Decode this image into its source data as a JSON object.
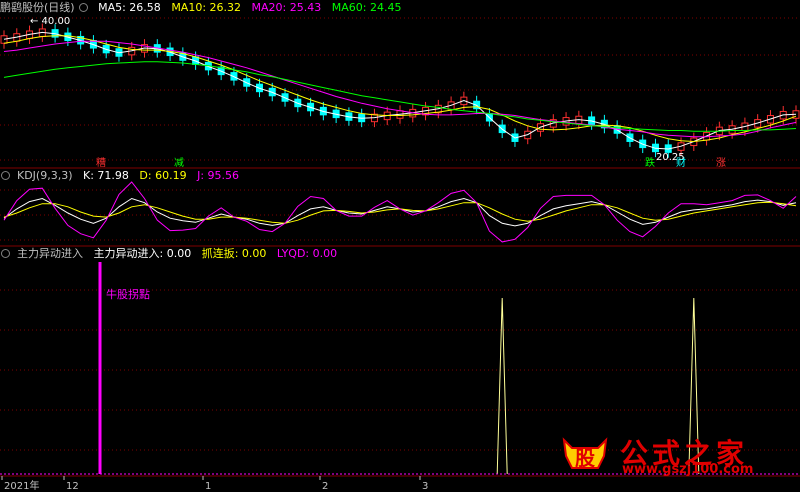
{
  "header_main": {
    "title": "鹏鹞股份(日线)",
    "ma5": "MA5: 26.58",
    "ma10": "MA10: 26.32",
    "ma20": "MA20: 25.43",
    "ma60": "MA60: 24.45"
  },
  "header_kdj": {
    "name": "KDJ(9,3,3)",
    "k": "K: 71.98",
    "d": "D: 60.19",
    "j": "J: 95.56"
  },
  "header_ind": {
    "name": "主力异动进入",
    "v1": "主力异动进入: 0.00",
    "v2": "抓连扳: 0.00",
    "v3": "LYQD: 0.00"
  },
  "colors": {
    "ma5": "#ffffff",
    "ma10": "#ffff00",
    "ma20": "#ff00ff",
    "ma60": "#00ff00",
    "up": "#ff3030",
    "down": "#00ffff",
    "grid": "#800000",
    "signal": "#ff00ff",
    "spike": "#ffff99"
  },
  "chart_data": [
    {
      "type": "candlestick",
      "panel": "price",
      "high_label": "40.00",
      "low_label": "20.25",
      "markers": [
        "糟",
        "减",
        "跌",
        "财",
        "涨"
      ],
      "series": [
        {
          "name": "MA5",
          "values": [
            37.6,
            37.9,
            38.3,
            38.6,
            38.4,
            37.9,
            37.4,
            36.8,
            36.1,
            35.6,
            35.9,
            36.3,
            36.2,
            35.7,
            35.0,
            34.4,
            33.6,
            32.9,
            32.1,
            31.2,
            30.4,
            29.8,
            29.0,
            28.2,
            27.6,
            27.0,
            26.6,
            26.2,
            26.0,
            26.1,
            26.4,
            26.6,
            26.8,
            27.1,
            27.4,
            27.9,
            28.6,
            27.9,
            26.1,
            24.4,
            23.1,
            23.6,
            24.7,
            25.3,
            25.6,
            25.8,
            25.6,
            25.1,
            24.3,
            23.1,
            22.2,
            21.6,
            21.5,
            21.9,
            22.6,
            23.4,
            24.2,
            24.4,
            24.8,
            25.3,
            25.9,
            26.5,
            26.6
          ]
        },
        {
          "name": "MA10",
          "values": [
            37.0,
            37.3,
            37.7,
            38.0,
            38.1,
            38.1,
            37.8,
            37.4,
            36.9,
            36.4,
            36.1,
            36.0,
            36.0,
            35.8,
            35.5,
            35.0,
            34.4,
            33.8,
            33.1,
            32.3,
            31.5,
            30.8,
            30.1,
            29.4,
            28.7,
            28.1,
            27.6,
            27.1,
            26.7,
            26.5,
            26.4,
            26.4,
            26.5,
            26.7,
            26.9,
            27.2,
            27.6,
            27.7,
            27.3,
            26.5,
            25.6,
            24.9,
            24.4,
            24.3,
            24.4,
            24.6,
            24.9,
            25.0,
            24.9,
            24.6,
            24.1,
            23.5,
            23.0,
            22.7,
            22.6,
            22.8,
            23.1,
            23.6,
            24.0,
            24.5,
            25.0,
            25.6,
            26.3
          ]
        },
        {
          "name": "MA20",
          "values": [
            35.8,
            36.0,
            36.3,
            36.6,
            36.9,
            37.1,
            37.3,
            37.3,
            37.3,
            37.1,
            36.9,
            36.6,
            36.3,
            36.0,
            35.7,
            35.3,
            34.9,
            34.4,
            33.9,
            33.4,
            32.8,
            32.2,
            31.6,
            31.0,
            30.4,
            29.8,
            29.2,
            28.7,
            28.2,
            27.8,
            27.4,
            27.1,
            26.8,
            26.6,
            26.5,
            26.5,
            26.6,
            26.7,
            26.7,
            26.6,
            26.4,
            26.1,
            25.8,
            25.6,
            25.4,
            25.2,
            25.0,
            24.7,
            24.4,
            24.2,
            24.0,
            23.7,
            23.5,
            23.4,
            23.3,
            23.3,
            23.4,
            23.5,
            23.7,
            24.1,
            24.6,
            25.0,
            25.4
          ]
        },
        {
          "name": "MA60",
          "values": [
            32.0,
            32.3,
            32.6,
            32.9,
            33.2,
            33.4,
            33.6,
            33.8,
            34.0,
            34.1,
            34.2,
            34.3,
            34.3,
            34.2,
            34.1,
            33.9,
            33.7,
            33.4,
            33.1,
            32.8,
            32.4,
            32.1,
            31.7,
            31.3,
            30.9,
            30.5,
            30.1,
            29.7,
            29.3,
            29.0,
            28.7,
            28.4,
            28.1,
            27.8,
            27.6,
            27.3,
            27.1,
            26.9,
            26.7,
            26.4,
            26.2,
            25.9,
            25.7,
            25.5,
            25.3,
            25.1,
            24.9,
            24.8,
            24.6,
            24.5,
            24.4,
            24.3,
            24.2,
            24.2,
            24.1,
            24.1,
            24.1,
            24.2,
            24.2,
            24.3,
            24.3,
            24.4,
            24.5
          ]
        }
      ]
    },
    {
      "type": "line",
      "panel": "kdj",
      "ylim": [
        0,
        100
      ],
      "series": [
        {
          "name": "K",
          "values": [
            40,
            58,
            72,
            78,
            65,
            50,
            38,
            30,
            40,
            62,
            78,
            70,
            52,
            40,
            35,
            32,
            40,
            48,
            42,
            38,
            30,
            26,
            30,
            45,
            58,
            62,
            55,
            50,
            48,
            55,
            62,
            58,
            52,
            54,
            62,
            72,
            78,
            70,
            45,
            30,
            25,
            30,
            45,
            58,
            64,
            68,
            72,
            66,
            52,
            38,
            28,
            32,
            42,
            52,
            56,
            58,
            62,
            66,
            72,
            75,
            72,
            65,
            70
          ]
        },
        {
          "name": "D",
          "values": [
            42,
            50,
            60,
            68,
            68,
            62,
            52,
            44,
            42,
            50,
            62,
            66,
            60,
            52,
            44,
            38,
            38,
            42,
            42,
            40,
            36,
            32,
            30,
            36,
            46,
            54,
            55,
            53,
            50,
            52,
            56,
            58,
            55,
            54,
            58,
            64,
            70,
            70,
            60,
            48,
            38,
            34,
            38,
            46,
            54,
            60,
            66,
            66,
            60,
            50,
            40,
            36,
            38,
            44,
            50,
            54,
            58,
            62,
            66,
            70,
            71,
            68,
            64
          ]
        },
        {
          "name": "J",
          "values": [
            36,
            74,
            96,
            98,
            59,
            26,
            10,
            2,
            36,
            86,
            110,
            78,
            36,
            16,
            17,
            20,
            44,
            60,
            42,
            34,
            18,
            14,
            30,
            63,
            82,
            78,
            55,
            44,
            44,
            61,
            74,
            58,
            46,
            54,
            70,
            88,
            94,
            70,
            15,
            -6,
            -1,
            22,
            59,
            82,
            84,
            84,
            84,
            66,
            36,
            14,
            4,
            24,
            50,
            68,
            68,
            66,
            70,
            74,
            84,
            85,
            74,
            59,
            82
          ]
        }
      ]
    },
    {
      "type": "bar",
      "panel": "indicator",
      "signal_label": "牛股拐點",
      "series": [
        {
          "name": "主力异动进入",
          "values": [
            0,
            0,
            0,
            0,
            0,
            0,
            0,
            0,
            0,
            0,
            0,
            0,
            0,
            0,
            0,
            0,
            0,
            0,
            0,
            0,
            0,
            0,
            0,
            0,
            0,
            0,
            0,
            0,
            0,
            0,
            0,
            0,
            0,
            0,
            0,
            0,
            0,
            0,
            0,
            1,
            0,
            0,
            0,
            0,
            0,
            0,
            0,
            0,
            0,
            0,
            0,
            0,
            0,
            0,
            1,
            0,
            0,
            0,
            0,
            0,
            0,
            0,
            0
          ]
        }
      ],
      "x_tick_labels": [
        "2021年",
        "12",
        "1",
        "2",
        "3"
      ]
    }
  ],
  "watermark": {
    "glyph": "股",
    "main": "公式之家",
    "url": "www.gszj100.com"
  }
}
